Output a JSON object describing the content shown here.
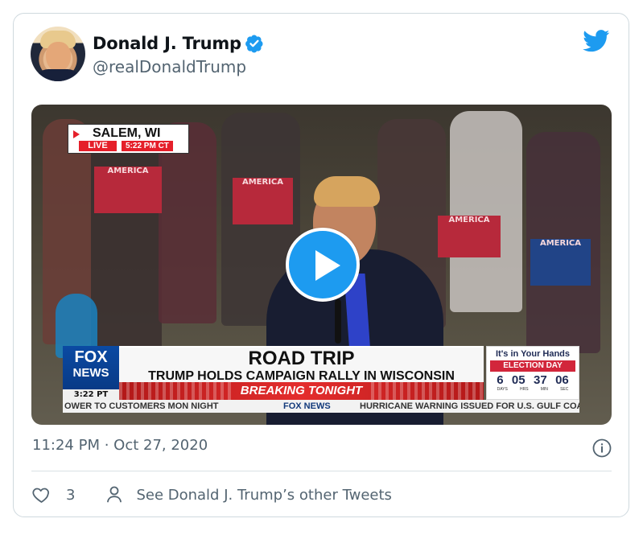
{
  "tweet": {
    "author_name": "Donald J. Trump",
    "handle": "@realDonaldTrump",
    "timestamp": "11:24 PM · Oct 27, 2020",
    "like_count": "3",
    "other_tweets_label": "See Donald J. Trump’s other Tweets"
  },
  "video": {
    "location": "SALEM, WI",
    "live_label": "LIVE",
    "time": "5:22 PM CT",
    "network_logo": "FOX NEWS",
    "network_time": "3:22 PT",
    "headline": "ROAD TRIP",
    "subheadline": "TRUMP HOLDS CAMPAIGN RALLY IN WISCONSIN",
    "breaking": "BREAKING TONIGHT",
    "countdown": {
      "title": "It's in Your Hands",
      "label": "ELECTION DAY",
      "values": [
        "6",
        "05",
        "37",
        "06"
      ],
      "units": [
        "DAYS",
        "HRS",
        "MIN",
        "SEC"
      ]
    },
    "ticker_left": "OWER TO CUSTOMERS MON NIGHT",
    "ticker_logo": "FOX NEWS",
    "ticker_right": "HURRICANE WARNING ISSUED FOR U.S. GULF COAST",
    "sign_words": [
      "AMERICA",
      "AMERICA",
      "AMERICA",
      "AMERICA"
    ]
  },
  "icons": {
    "verified": "verified-badge-icon",
    "twitter": "twitter-bird-icon",
    "play": "play-icon",
    "info": "info-icon",
    "like": "heart-icon",
    "profile": "person-icon"
  },
  "colors": {
    "accent": "#1d9bf0",
    "muted_text": "#536471",
    "card_border": "#cfd9de"
  }
}
